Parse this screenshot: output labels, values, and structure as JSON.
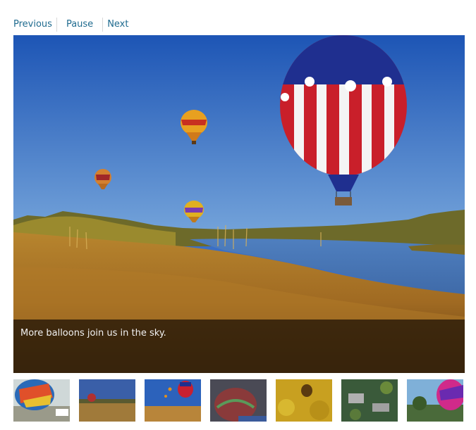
{
  "controls": {
    "previous_label": "Previous",
    "pause_label": "Pause",
    "next_label": "Next"
  },
  "slide": {
    "caption": "More balloons join us in the sky.",
    "image_alt": "Hot air balloons over a river with golden grass"
  },
  "colors": {
    "link": "#1f6b8f",
    "caption_overlay": "#140c04",
    "sky": "#2f6ac3"
  },
  "thumbnails": [
    {
      "alt": "Balloon inflating on launch field",
      "icon": "thumbnail-image"
    },
    {
      "alt": "Balloon at sunset over field",
      "icon": "thumbnail-image"
    },
    {
      "alt": "Balloons over river",
      "icon": "thumbnail-image"
    },
    {
      "alt": "Balloon envelope close-up",
      "icon": "thumbnail-image"
    },
    {
      "alt": "Balloon shadow on yellow trees",
      "icon": "thumbnail-image"
    },
    {
      "alt": "Aerial view of town",
      "icon": "thumbnail-image"
    },
    {
      "alt": "Colorful balloon near trees",
      "icon": "thumbnail-image"
    }
  ]
}
